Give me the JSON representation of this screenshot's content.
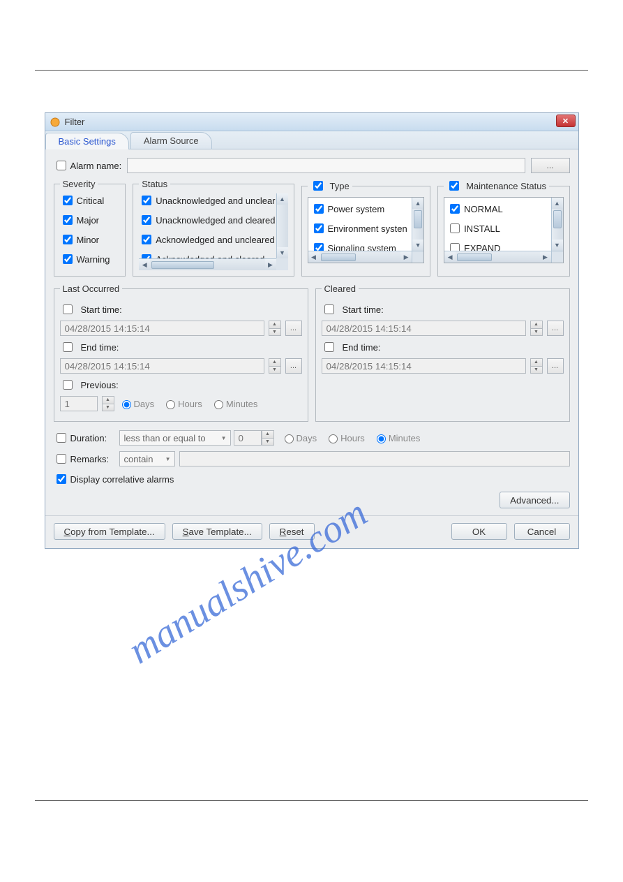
{
  "dialog": {
    "title": "Filter"
  },
  "tabs": {
    "basic": "Basic Settings",
    "alarm_source": "Alarm Source"
  },
  "alarm_name": {
    "label": "Alarm name:",
    "value": "",
    "browse": "..."
  },
  "severity": {
    "legend": "Severity",
    "items": {
      "critical": "Critical",
      "major": "Major",
      "minor": "Minor",
      "warning": "Warning"
    }
  },
  "status": {
    "legend": "Status",
    "items": {
      "unack_unclear": "Unacknowledged and unclear",
      "unack_cleared": "Unacknowledged and cleared",
      "ack_unclear": "Acknowledged and uncleared",
      "ack_cleared": "Acknowledged and cleared"
    }
  },
  "type": {
    "legend": "Type",
    "items": {
      "power": "Power system",
      "env": "Environment systen",
      "signal": "Signaling system"
    }
  },
  "maint": {
    "legend": "Maintenance Status",
    "items": {
      "normal": "NORMAL",
      "install": "INSTALL",
      "expand": "EXPAND"
    }
  },
  "last_occurred": {
    "legend": "Last Occurred",
    "start_label": "Start time:",
    "start_value": "04/28/2015 14:15:14",
    "end_label": "End time:",
    "end_value": "04/28/2015 14:15:14",
    "previous_label": "Previous:",
    "previous_value": "1",
    "units": {
      "days": "Days",
      "hours": "Hours",
      "minutes": "Minutes"
    }
  },
  "cleared": {
    "legend": "Cleared",
    "start_label": "Start time:",
    "start_value": "04/28/2015 14:15:14",
    "end_label": "End time:",
    "end_value": "04/28/2015 14:15:14"
  },
  "duration": {
    "label": "Duration:",
    "op": "less than or equal to",
    "value": "0",
    "units": {
      "days": "Days",
      "hours": "Hours",
      "minutes": "Minutes"
    }
  },
  "remarks": {
    "label": "Remarks:",
    "op": "contain",
    "value": ""
  },
  "display_corr": "Display correlative alarms",
  "advanced": "Advanced...",
  "buttons": {
    "copy": "opy from Template...",
    "copy_u": "C",
    "save": "ave Template...",
    "save_u": "S",
    "reset": "eset",
    "reset_u": "R",
    "ok": "OK",
    "cancel": "Cancel"
  },
  "time_browse": "...",
  "watermark": "manualshive.com"
}
